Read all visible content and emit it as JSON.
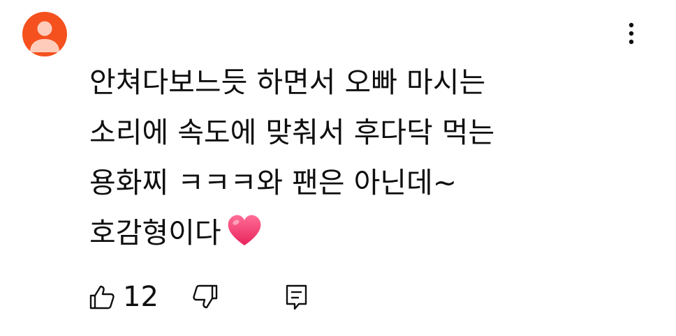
{
  "comment": {
    "lines": [
      "안쳐다보느듯 하면서 오빠 마시는",
      "소리에 속도에 맞춰서 후다닥 먹는",
      "용화찌 ㅋㅋㅋ와 팬은 아닌데~",
      "호감형이다"
    ],
    "emoji": "heart"
  },
  "actions": {
    "like_count": "12"
  },
  "colors": {
    "avatar_bg": "#f4511e",
    "avatar_figure": "#ffccbc",
    "heart": "#f0346b",
    "text": "#0f0f0f"
  },
  "icons": {
    "avatar": "user-silhouette",
    "more": "vertical-ellipsis",
    "like": "thumbs-up-outline",
    "dislike": "thumbs-down-outline",
    "reply": "comment-outline"
  }
}
